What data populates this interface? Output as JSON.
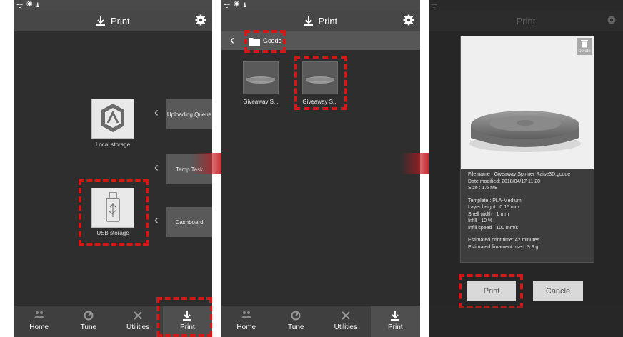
{
  "screen1": {
    "header_title": "Print",
    "storage": [
      {
        "label": "Local storage"
      },
      {
        "label": "USB storage"
      }
    ],
    "side_buttons": [
      {
        "label": "Uploading Queue"
      },
      {
        "label": "Temp Task"
      },
      {
        "label": "Dashboard"
      }
    ],
    "tabs": [
      {
        "label": "Home",
        "icon": "people-icon"
      },
      {
        "label": "Tune",
        "icon": "gauge-icon"
      },
      {
        "label": "Utilities",
        "icon": "tools-icon"
      },
      {
        "label": "Print",
        "icon": "download-icon",
        "active": true
      }
    ]
  },
  "screen2": {
    "header_title": "Print",
    "folder_name": "Gcode",
    "files": [
      {
        "label": "Giveaway S..."
      },
      {
        "label": "Giveaway S..."
      }
    ],
    "tabs": [
      {
        "label": "Home"
      },
      {
        "label": "Tune"
      },
      {
        "label": "Utilities"
      },
      {
        "label": "Print",
        "active": true
      }
    ]
  },
  "screen3": {
    "header_title": "Print",
    "delete_label": "Delete",
    "file_info": {
      "file_name": "File name : Giveaway Spinner Raise3D.gcode",
      "date_modified": "Date modified: 2018/04/17 11:20",
      "size": "Size : 1.6 MB",
      "template": "Template : PLA-Medium",
      "layer_height": "Layer height : 0.15 mm",
      "shell_width": "Shell width : 1 mm",
      "infill": "Infill : 10 %",
      "infill_speed": "Infill speed : 100 mm/s",
      "est_time": "Estimated print time: 42 minutes",
      "est_filament": "Estimated fimament used: 9.9 g"
    },
    "print_label": "Print",
    "cancel_label": "Cancle"
  },
  "colors": {
    "highlight": "#d11919",
    "arrow": "#c4161c",
    "panel_bg": "#2e2e2e"
  }
}
